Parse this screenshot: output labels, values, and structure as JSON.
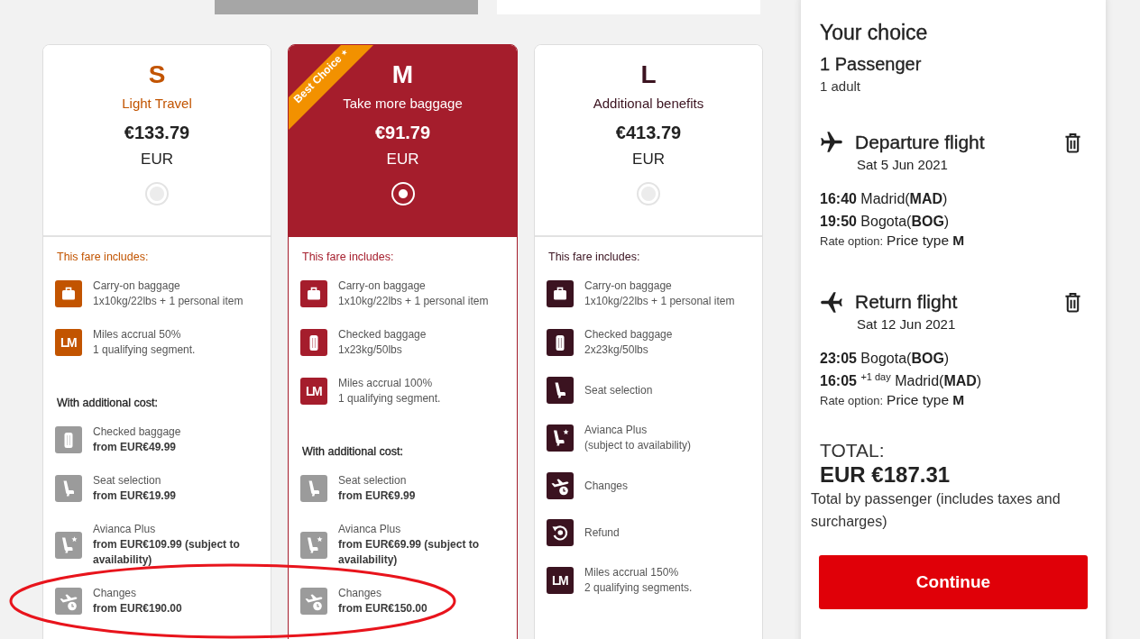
{
  "top_tabs": [
    {
      "selected": true
    },
    {
      "selected": false
    }
  ],
  "fare_cards": [
    {
      "code": "S",
      "subtitle": "Light Travel",
      "price": "€133.79",
      "currency": "EUR",
      "selected": false,
      "color": "#c25400",
      "includes_heading": "This fare includes:",
      "includes": [
        {
          "kind": "carry-on",
          "title": "Carry-on baggage",
          "detail": "1x10kg/22lbs + 1 personal item"
        },
        {
          "kind": "miles",
          "icon_text": "LM",
          "title": "Miles accrual 50%",
          "detail": "1 qualifying segment."
        }
      ],
      "extras_heading": "With additional cost:",
      "extras": [
        {
          "kind": "checked-bag",
          "title": "Checked baggage",
          "detail": "from EUR€49.99"
        },
        {
          "kind": "seat",
          "title": "Seat selection",
          "detail": "from EUR€19.99"
        },
        {
          "kind": "seat-plus",
          "title": "Avianca Plus",
          "detail": "from EUR€109.99 (subject to availability)"
        },
        {
          "kind": "changes",
          "title": "Changes",
          "detail": "from EUR€190.00"
        }
      ]
    },
    {
      "code": "M",
      "badge": "Best Choice",
      "subtitle": "Take more baggage",
      "price": "€91.79",
      "currency": "EUR",
      "selected": true,
      "color": "#a51d2c",
      "includes_heading": "This fare includes:",
      "includes": [
        {
          "kind": "carry-on",
          "title": "Carry-on baggage",
          "detail": "1x10kg/22lbs + 1 personal item"
        },
        {
          "kind": "checked-bag",
          "title": "Checked baggage",
          "detail": "1x23kg/50lbs"
        },
        {
          "kind": "miles",
          "icon_text": "LM",
          "title": "Miles accrual 100%",
          "detail": "1 qualifying segment."
        }
      ],
      "extras_heading": "With additional cost:",
      "extras": [
        {
          "kind": "seat",
          "title": "Seat selection",
          "detail": "from EUR€9.99"
        },
        {
          "kind": "seat-plus",
          "title": "Avianca Plus",
          "detail": "from EUR€69.99 (subject to availability)"
        },
        {
          "kind": "changes",
          "title": "Changes",
          "detail": "from EUR€150.00"
        }
      ]
    },
    {
      "code": "L",
      "subtitle": "Additional benefits",
      "price": "€413.79",
      "currency": "EUR",
      "selected": false,
      "color": "#3b1320",
      "includes_heading": "This fare includes:",
      "includes": [
        {
          "kind": "carry-on",
          "title": "Carry-on baggage",
          "detail": "1x10kg/22lbs + 1 personal item"
        },
        {
          "kind": "checked-bag",
          "title": "Checked baggage",
          "detail": "2x23kg/50lbs"
        },
        {
          "kind": "seat",
          "title": "Seat selection"
        },
        {
          "kind": "seat-plus",
          "title": "Avianca Plus",
          "detail": "(subject to availability)"
        },
        {
          "kind": "changes",
          "title": "Changes"
        },
        {
          "kind": "refund",
          "title": "Refund"
        },
        {
          "kind": "miles",
          "icon_text": "LM",
          "title": "Miles accrual 150%",
          "detail": "2 qualifying segments."
        }
      ]
    }
  ],
  "annotation": {
    "kind": "ellipse"
  },
  "summary": {
    "title": "Your choice",
    "passengers": "1 Passenger",
    "passenger_detail": "1 adult",
    "flights": [
      {
        "kind": "departure",
        "title": "Departure flight",
        "date": "Sat 5 Jun 2021",
        "segments": [
          "**16:40** Madrid(**MAD**)",
          "**19:50** Bogota(**BOG**)"
        ],
        "rate_label": "Rate option:",
        "rate_value": "Price type **M**"
      },
      {
        "kind": "return",
        "title": "Return flight",
        "date": "Sat 12 Jun 2021",
        "segments": [
          "**23:05** Bogota(**BOG**)",
          "**16:05** $^{+1 day}$ Madrid(**MAD**)"
        ],
        "rate_label": "Rate option:",
        "rate_value": "Price type **M**"
      }
    ],
    "total_label": "TOTAL:",
    "total": "EUR €187.31",
    "total_note": "Total by passenger (includes taxes and surcharges)",
    "continue": "Continue"
  }
}
